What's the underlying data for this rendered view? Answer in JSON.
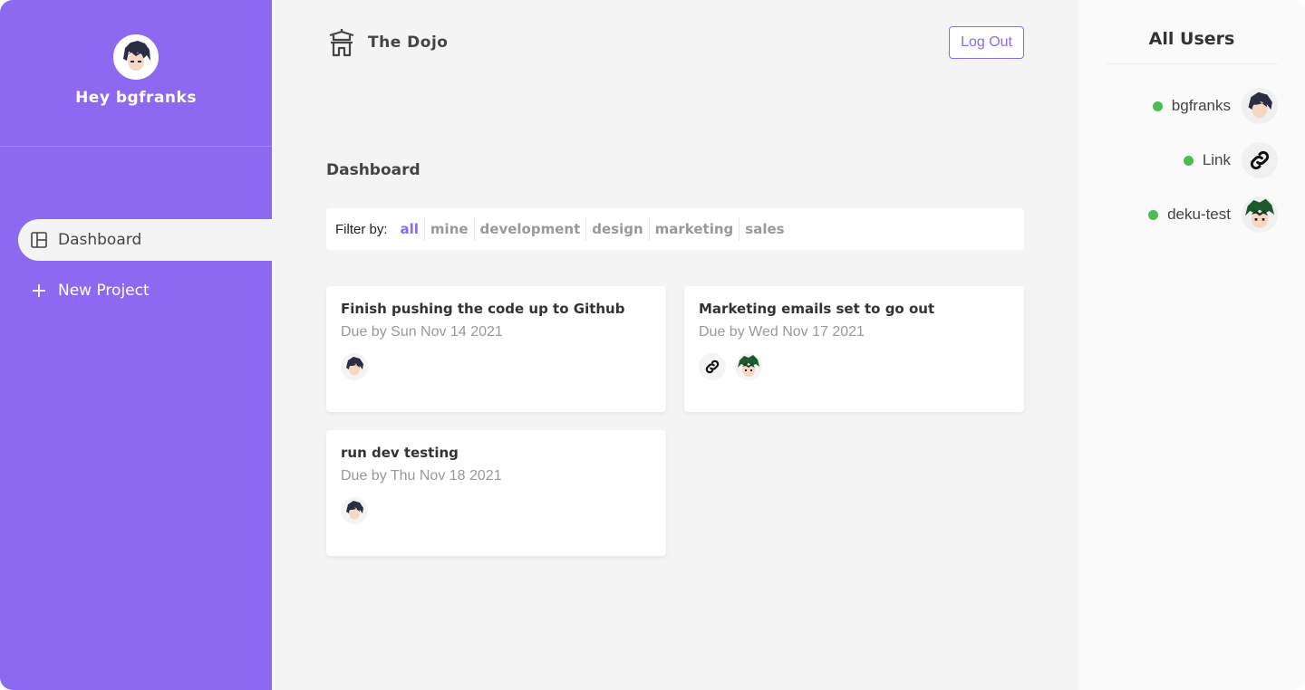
{
  "sidebar": {
    "greeting": "Hey bgfranks",
    "avatar_icon": "anime-avatar-icon",
    "nav": [
      {
        "label": "Dashboard",
        "icon": "dashboard-icon",
        "active": true
      },
      {
        "label": "New Project",
        "icon": "plus-icon",
        "active": false
      }
    ]
  },
  "navbar": {
    "logo_icon": "temple-icon",
    "brand": "The Dojo",
    "logout_label": "Log Out"
  },
  "main": {
    "title": "Dashboard",
    "filter": {
      "label": "Filter by:",
      "options": [
        "all",
        "mine",
        "development",
        "design",
        "marketing",
        "sales"
      ],
      "selected": "all"
    },
    "projects": [
      {
        "title": "Finish pushing the code up to Github",
        "due": "Due by Sun Nov 14 2021",
        "assignees": [
          "bgfranks"
        ]
      },
      {
        "title": "Marketing emails set to go out",
        "due": "Due by Wed Nov 17 2021",
        "assignees": [
          "Link",
          "deku-test"
        ]
      },
      {
        "title": "run dev testing",
        "due": "Due by Thu Nov 18 2021",
        "assignees": [
          "bgfranks"
        ]
      }
    ]
  },
  "users_panel": {
    "title": "All Users",
    "users": [
      {
        "name": "bgfranks",
        "online": true,
        "avatar": "dark-hair-avatar-icon"
      },
      {
        "name": "Link",
        "online": true,
        "avatar": "link-chain-icon"
      },
      {
        "name": "deku-test",
        "online": true,
        "avatar": "green-hair-avatar-icon"
      }
    ]
  },
  "colors": {
    "accent": "#8d69f1",
    "online": "#4cbb53",
    "background": "#f4f4f4"
  }
}
